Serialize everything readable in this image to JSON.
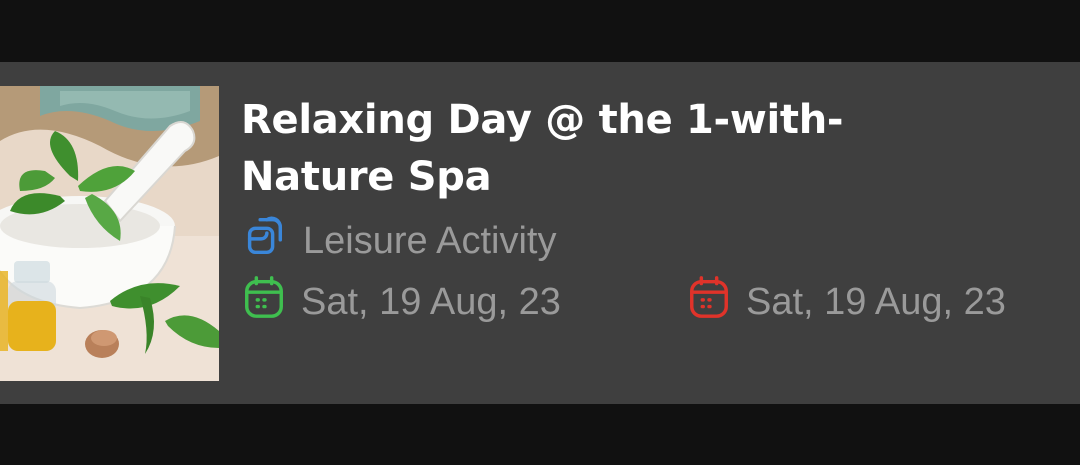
{
  "event": {
    "title": "Relaxing Day @ the 1-with-Nature Spa",
    "category": "Leisure Activity",
    "start_date": "Sat, 19 Aug, 23",
    "end_date": "Sat, 19 Aug, 23"
  },
  "icons": {
    "category": "copy-icon",
    "start": "calendar-icon",
    "end": "calendar-icon"
  },
  "colors": {
    "background": "#111111",
    "card": "#3f3f3f",
    "title": "#ffffff",
    "meta_text": "#9a9a9a",
    "category_icon": "#3a86d9",
    "start_icon": "#3fbf4f",
    "end_icon": "#e0332a"
  }
}
